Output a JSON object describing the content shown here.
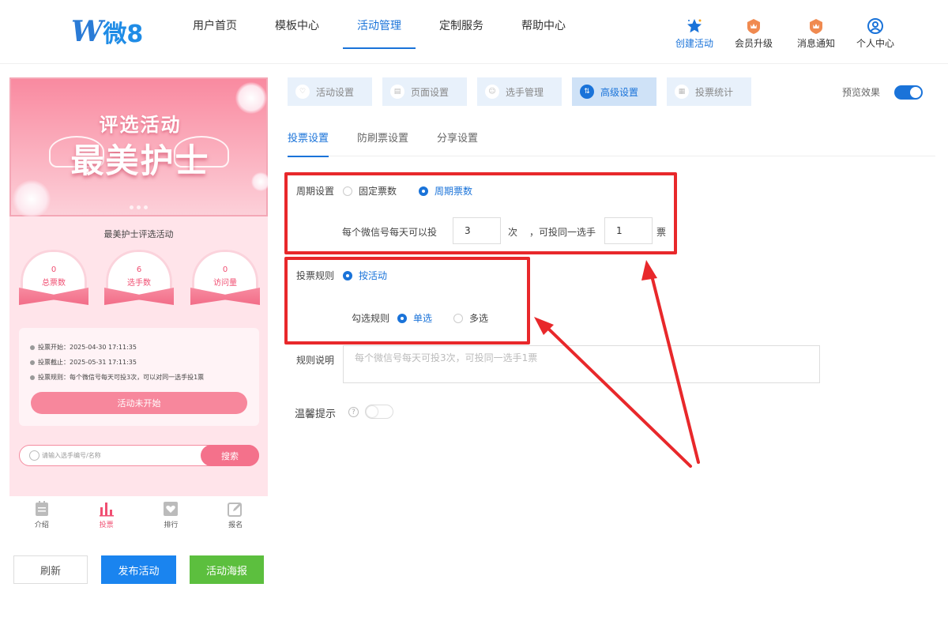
{
  "logo": {
    "w": "W",
    "text": "微8"
  },
  "nav": [
    "用户首页",
    "模板中心",
    "活动管理",
    "定制服务",
    "帮助中心"
  ],
  "nav_active": 2,
  "quick": {
    "create": "创建活动",
    "upgrade": "会员升级",
    "notify": "消息通知",
    "profile": "个人中心"
  },
  "phone": {
    "banner_line1": "评选活动",
    "banner_line2": "最美护士",
    "activity_name": "最美护士评选活动",
    "stats": [
      {
        "value": "0",
        "label": "总票数"
      },
      {
        "value": "6",
        "label": "选手数"
      },
      {
        "value": "0",
        "label": "访问量"
      }
    ],
    "info_start": "投票开始：2025-04-30 17:11:35",
    "info_end": "投票截止：2025-05-31 17:11:35",
    "info_rule": "投票规则：每个微信号每天可投3次，可以对同一选手投1票",
    "status_button": "活动未开始",
    "search_placeholder": "请输入选手编号/名称",
    "search_button": "搜索",
    "tabbar": [
      "介绍",
      "投票",
      "排行",
      "报名"
    ],
    "tabbar_active": 1
  },
  "actions": {
    "refresh": "刷新",
    "publish": "发布活动",
    "poster": "活动海报"
  },
  "steps": [
    "活动设置",
    "页面设置",
    "选手管理",
    "高级设置",
    "投票统计"
  ],
  "step_active": 3,
  "preview_label": "预览效果",
  "subtabs": [
    "投票设置",
    "防刷票设置",
    "分享设置"
  ],
  "subtab_active": 0,
  "cycle": {
    "label": "周期设置",
    "opt_fixed": "固定票数",
    "opt_cycle": "周期票数",
    "per_day_prefix": "每个微信号每天可以投",
    "per_day_value": "3",
    "times_unit": "次",
    "same_player": "，可投同一选手",
    "same_player_value": "1",
    "vote_unit": "票"
  },
  "rule": {
    "label": "投票规则",
    "by_activity": "按活动",
    "check_label": "勾选规则",
    "single": "单选",
    "multi": "多选"
  },
  "desc": {
    "label": "规则说明",
    "placeholder": "每个微信号每天可投3次，可投同一选手1票"
  },
  "tip": {
    "label": "温馨提示",
    "help": "?"
  },
  "colors": {
    "accent": "#1a73d9",
    "annotation": "#e8282b",
    "pink": "#f4718b",
    "green": "#5cbf3e"
  }
}
